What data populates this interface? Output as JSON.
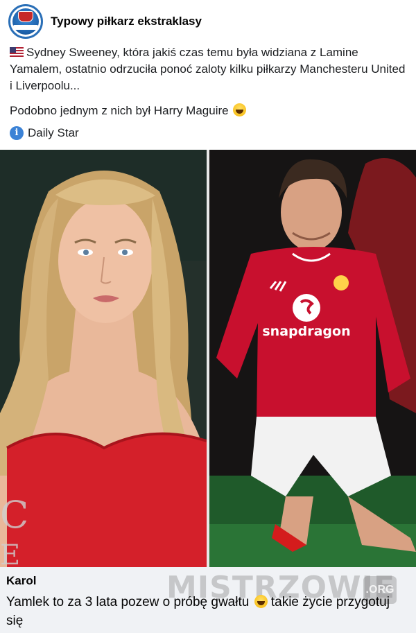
{
  "post": {
    "page_name": "Typowy piłkarz ekstraklasy",
    "text_line1": "Sydney Sweeney, która jakiś czas temu była widziana z Lamine Yamalem, ostatnio odrzuciła ponoć zaloty kilku piłkarzy Manchesteru United i Liverpoolu...",
    "text_line2": "Podobno jednym z nich był Harry Maguire",
    "source": "Daily Star",
    "icons": [
      "us-flag-icon",
      "laughing-emoji-icon",
      "info-icon"
    ]
  },
  "photos": {
    "right_photo_texts": [
      "snapdragon"
    ]
  },
  "comment": {
    "author": "Karol",
    "text": "Yamlek to za 3 lata pozew o próbę gwałtu",
    "text_after_emoji": "takie życie przygotuj się"
  },
  "watermark": {
    "brand": "MISTRZOWIE",
    "suffix": ".ORG"
  },
  "colors": {
    "info_blue": "#3b82d6",
    "comment_bg": "#f0f2f5",
    "jersey_red": "#c8102e"
  }
}
